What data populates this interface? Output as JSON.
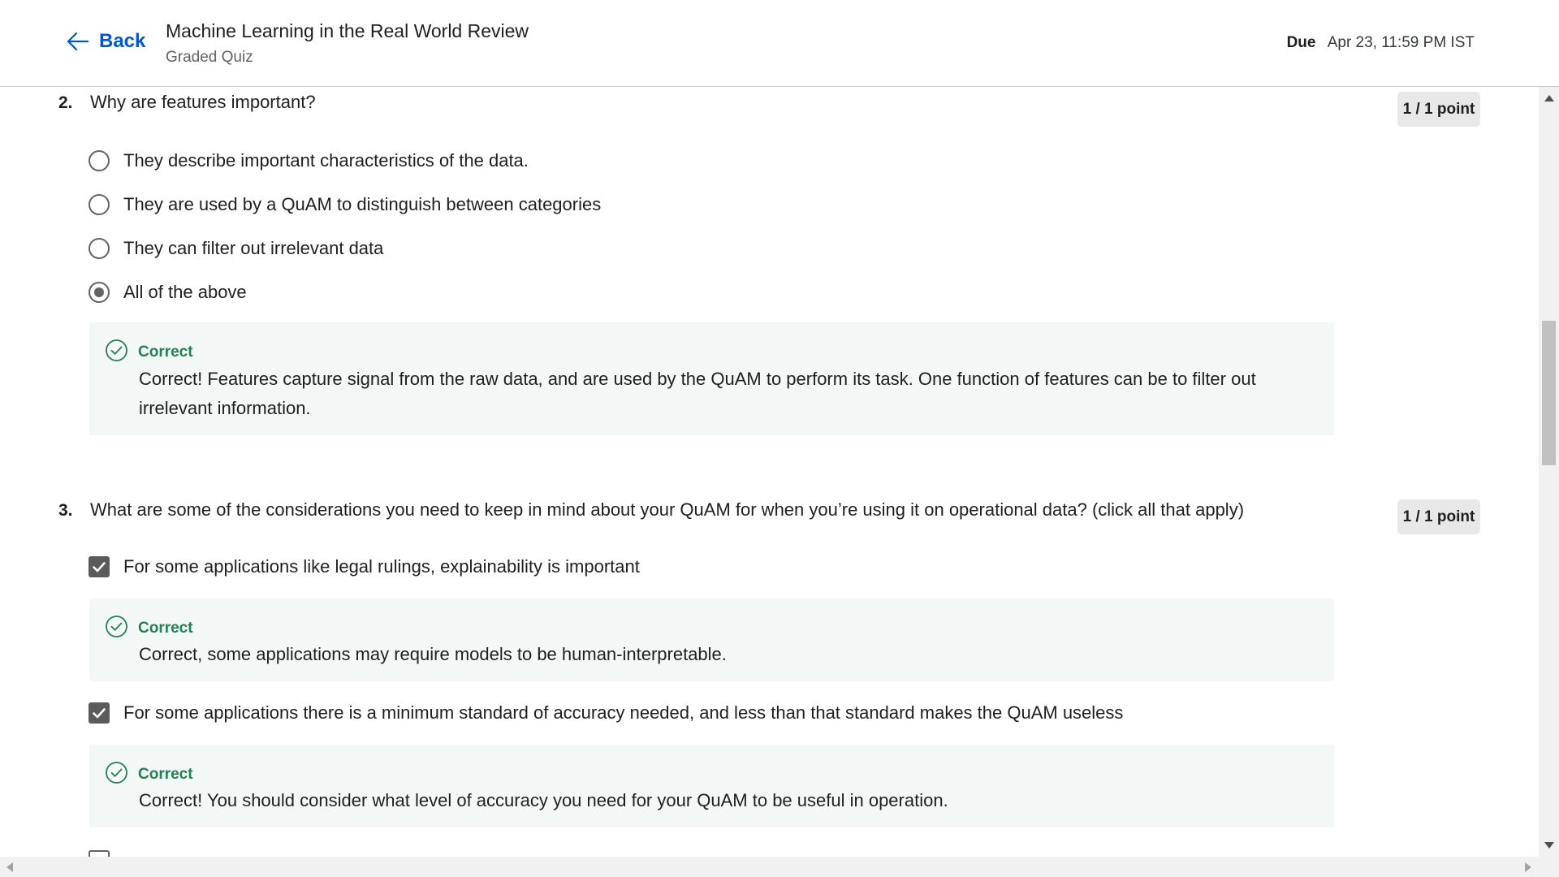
{
  "header": {
    "back_label": "Back",
    "title": "Machine Learning in the Real World Review",
    "subtitle": "Graded Quiz",
    "due_label": "Due",
    "due_value": "Apr 23, 11:59 PM IST"
  },
  "questions": [
    {
      "number": "2.",
      "text": "Why are features important?",
      "points": "1 / 1 point",
      "type": "single",
      "options": [
        {
          "label": "They describe important characteristics of the data.",
          "selected": false
        },
        {
          "label": "They are used by a QuAM to distinguish between categories",
          "selected": false
        },
        {
          "label": "They can filter out irrelevant data",
          "selected": false
        },
        {
          "label": "All of the above",
          "selected": true
        }
      ],
      "feedback": {
        "status": "Correct",
        "text": "Correct! Features capture signal from the raw data, and are used by the QuAM to perform its task. One function of features can be to filter out irrelevant information."
      }
    },
    {
      "number": "3.",
      "text": "What are some of the considerations you need to keep in mind about your QuAM for when you’re using it on operational data? (click all that apply)",
      "points": "1 / 1 point",
      "type": "multiple",
      "options": [
        {
          "label": "For some applications like legal rulings, explainability is important",
          "selected": true,
          "feedback": {
            "status": "Correct",
            "text": "Correct, some applications may require models to be human-interpretable."
          }
        },
        {
          "label": "For some applications there is a minimum standard of accuracy needed, and less than that standard makes the QuAM useless",
          "selected": true,
          "feedback": {
            "status": "Correct",
            "text": "Correct! You should consider what level of accuracy you need for your QuAM to be useful in operation."
          }
        }
      ]
    }
  ],
  "colors": {
    "accent": "#0056d2",
    "correct": "#1f8354",
    "feedback_bg": "#f3f8f6",
    "points_bg": "#e8e8e8"
  }
}
